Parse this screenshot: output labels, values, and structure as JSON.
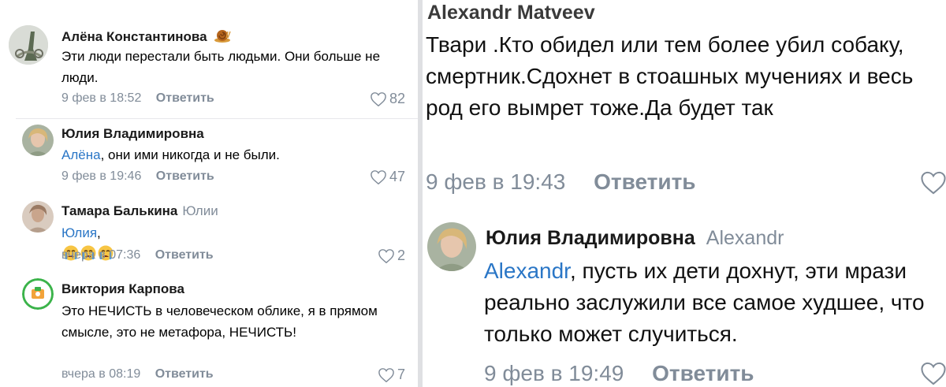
{
  "left_thread": {
    "comments": [
      {
        "author": "Алёна Константинова",
        "badge": "snail-emoji",
        "text": "Эти люди перестали быть людьми. Они больше не люди.",
        "date": "9 фев в 18:52",
        "reply_label": "Ответить",
        "likes": "82"
      },
      {
        "author": "Юлия Владимировна",
        "mention": "Алёна",
        "text_rest": ", они ими никогда и не были.",
        "date": "9 фев в 19:46",
        "reply_label": "Ответить",
        "likes": "47"
      },
      {
        "author": "Тамара Балькина",
        "reply_to": "Юлии",
        "mention": "Юлия",
        "text_rest": ",",
        "emojis": [
          "crying-face-emoji",
          "crying-face-emoji",
          "crying-face-emoji"
        ],
        "date": "вчера в 07:36",
        "reply_label": "Ответить",
        "likes": "2"
      },
      {
        "author": "Виктория Карпова",
        "text": "Это НЕЧИСТЬ в человеческом облике, я в прямом смысле, это не метафора, НЕЧИСТЬ!",
        "date": "вчера в 08:19",
        "reply_label": "Ответить",
        "likes": "7"
      }
    ]
  },
  "right_thread": {
    "comments": [
      {
        "author": "Alexandr Matveev",
        "text": "Твари .Кто обидел или тем более убил собаку, смертник.Сдохнет в стоашных мучениях и весь род его вымрет тоже.Да будет так",
        "date": "9 фев в 19:43",
        "reply_label": "Ответить"
      },
      {
        "author": "Юлия Владимировна",
        "reply_to": "Alexandr",
        "mention": "Alexandr",
        "text_rest": ", пусть их дети дохнут, эти мрази реально заслужили все самое худшее, что только может случиться.",
        "date": "9 фев в 19:49",
        "reply_label": "Ответить"
      }
    ]
  },
  "colors": {
    "mention": "#2a76c6",
    "meta_gray": "#818c99",
    "divider": "#dfe0e3"
  }
}
